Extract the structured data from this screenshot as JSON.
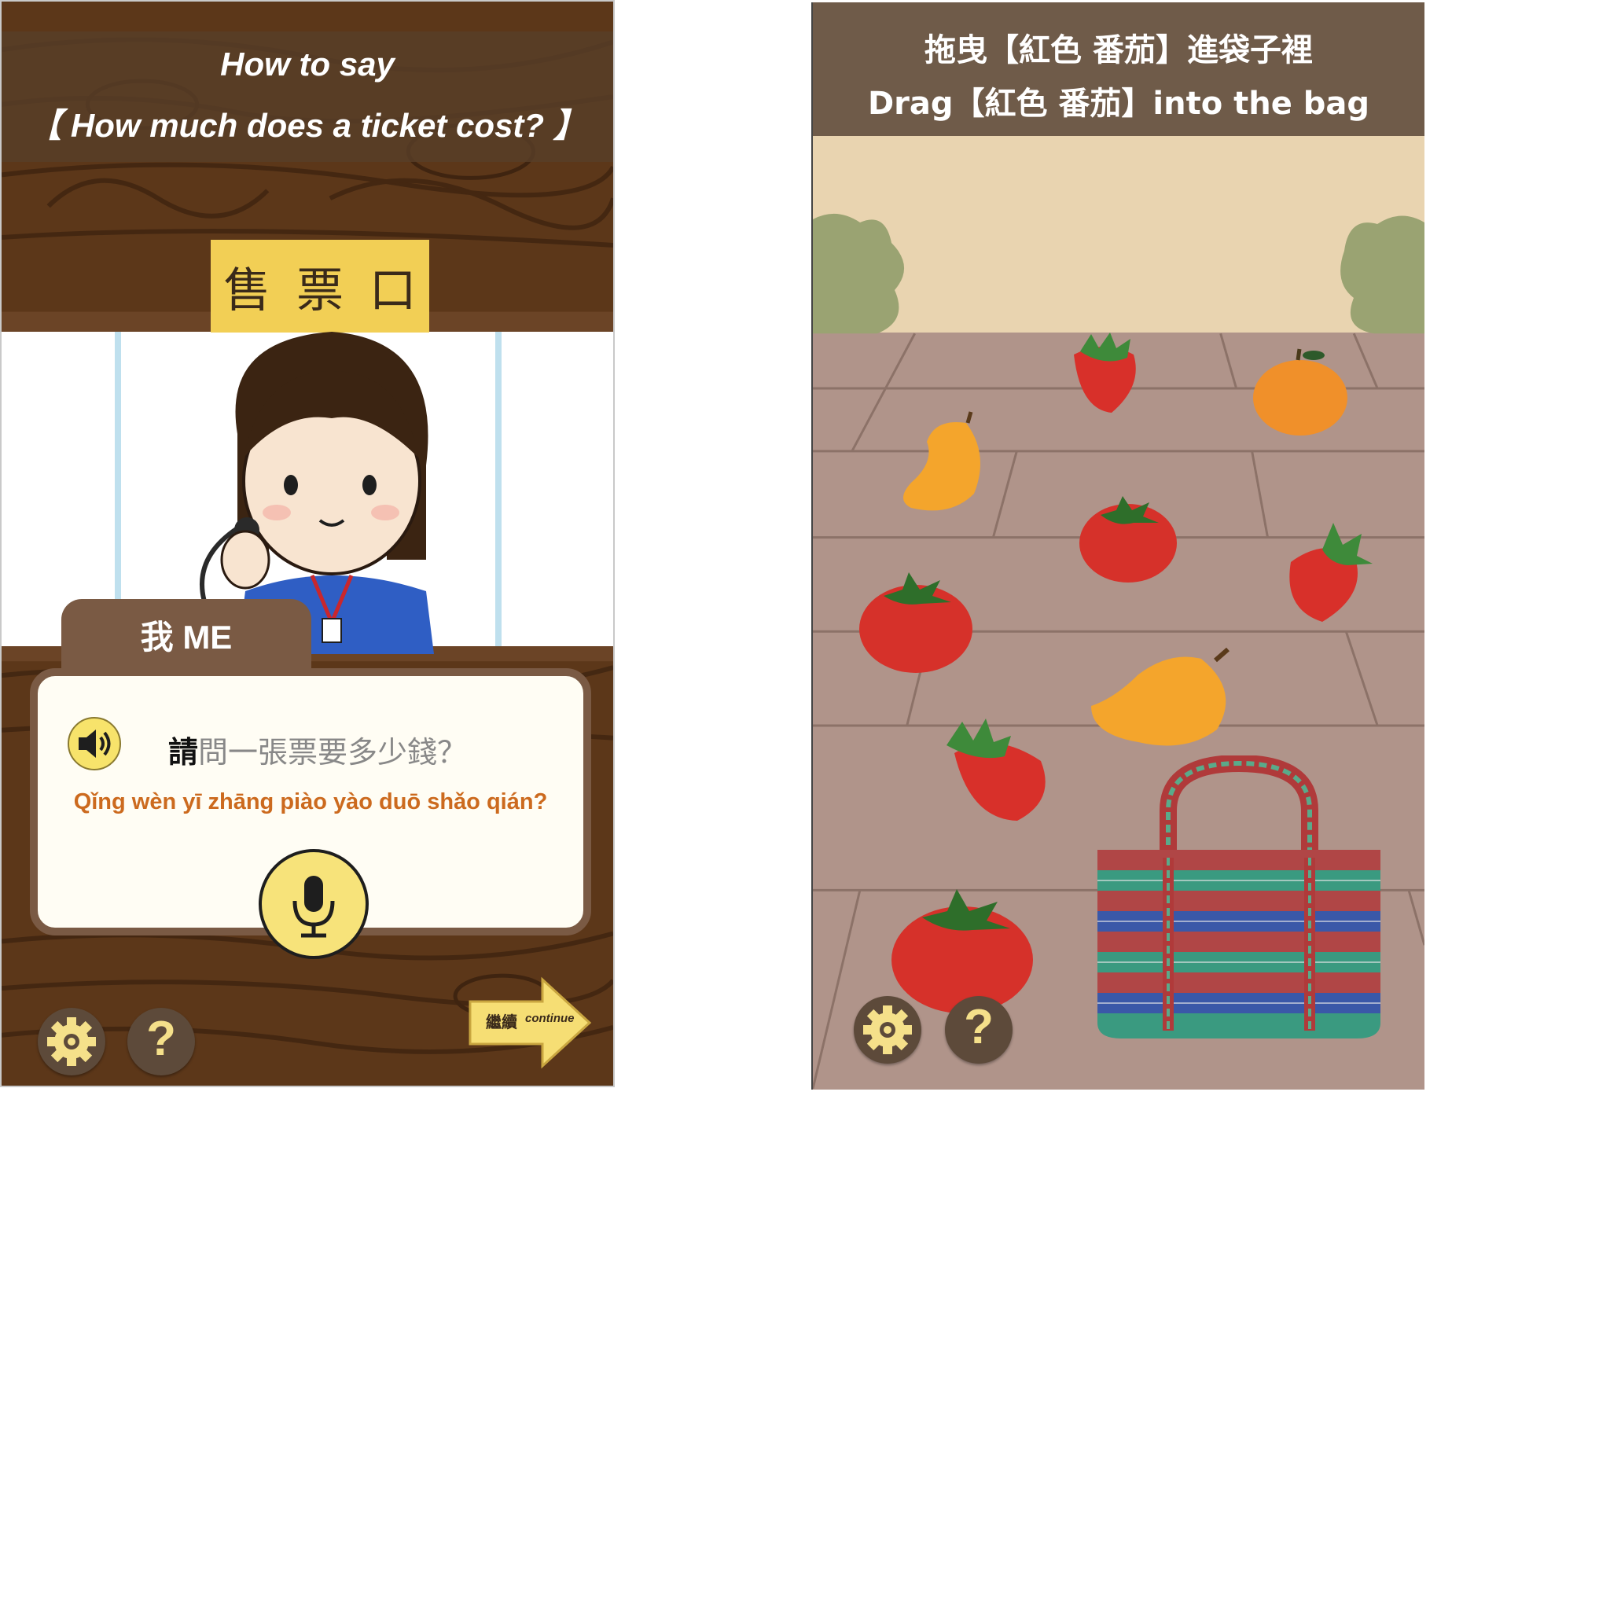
{
  "left_screen": {
    "title_line1": "How to say",
    "title_line2": "【 How much does a ticket cost? 】",
    "sign_text": [
      "售",
      "票",
      "口"
    ],
    "speaker_tab": "我  ME",
    "sentence_highlight": "請",
    "sentence_rest": "問一張票要多少錢？",
    "pinyin": "Qǐng wèn yī zhāng piào yào duō shǎo qián?",
    "continue_zh": "繼續",
    "continue_en": "continue",
    "help_symbol": "?",
    "icons": [
      "speaker-icon",
      "microphone-icon",
      "gear-icon",
      "help-icon",
      "continue-arrow-icon"
    ]
  },
  "right_screen": {
    "instruction_zh": "拖曳【紅色 番茄】進袋子裡",
    "instruction_en": "Drag【紅色 番茄】into the bag",
    "help_symbol": "?",
    "items": [
      "strawberry",
      "orange",
      "mango",
      "tomato",
      "strawberry",
      "tomato",
      "mango",
      "strawberry",
      "tomato"
    ],
    "icons": [
      "gear-icon",
      "help-icon",
      "bag-icon"
    ]
  },
  "colors": {
    "title_band": "#583e28",
    "card_border": "#7a5a44",
    "pinyin": "#cc6a1e",
    "button_yellow": "#f7e37a",
    "header_right": "#6f5b49"
  }
}
